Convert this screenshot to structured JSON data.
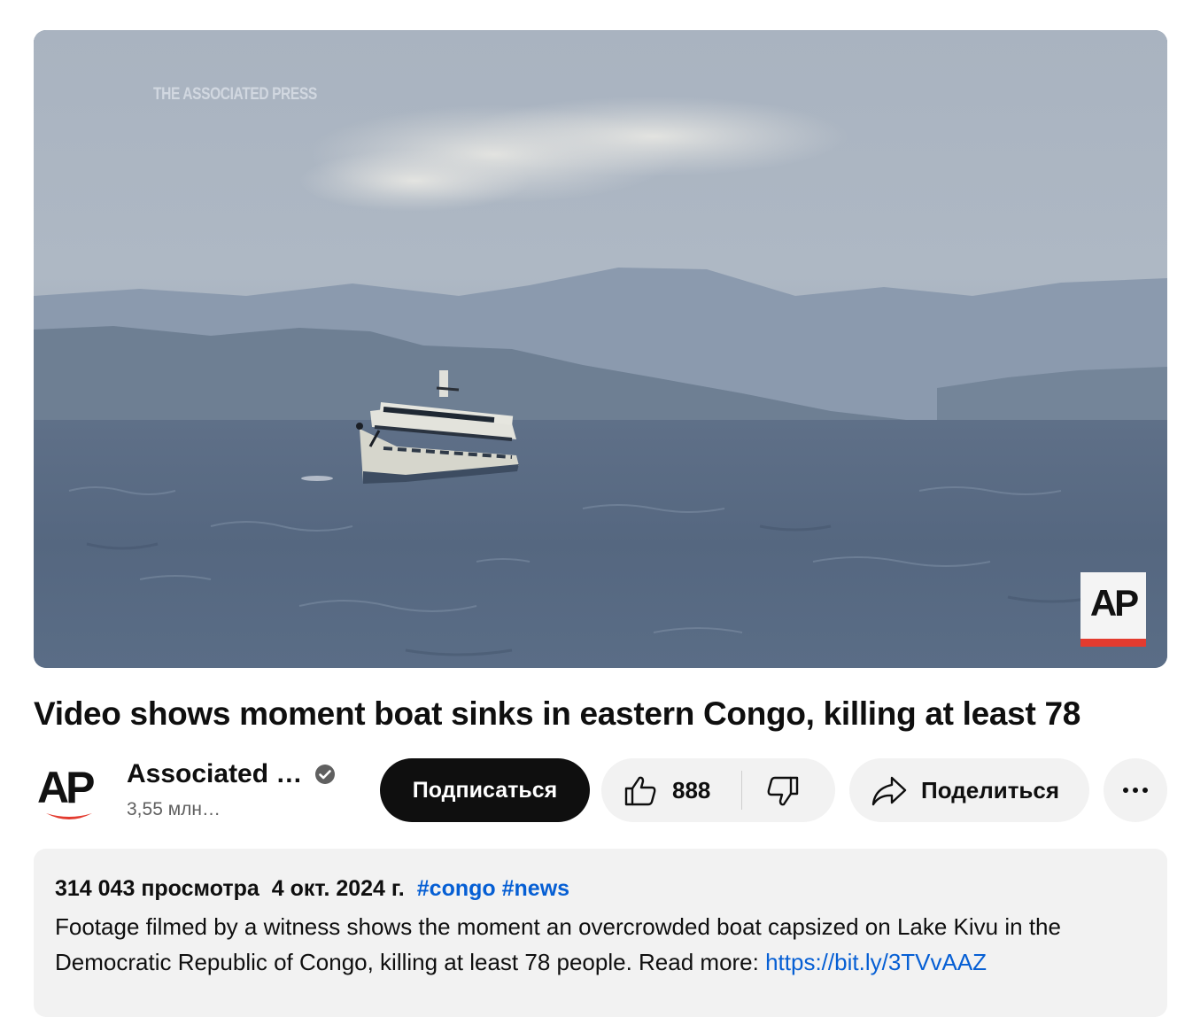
{
  "video": {
    "watermark": "THE ASSOCIATED PRESS",
    "badge_text": "AP"
  },
  "title": "Video shows moment boat sinks in eastern Congo, killing at least 78",
  "channel": {
    "avatar_text": "AP",
    "name": "Associated …",
    "subscribers": "3,55 млн…",
    "verified_icon": "check-circle-icon"
  },
  "actions": {
    "subscribe_label": "Подписаться",
    "like_count": "888",
    "share_label": "Поделиться",
    "icons": [
      "thumb-up-icon",
      "thumb-down-icon",
      "share-arrow-icon",
      "more-icon"
    ]
  },
  "description": {
    "views": "314 043 просмотра",
    "date": "4 окт. 2024 г.",
    "hashtags": [
      "#congo",
      "#news"
    ],
    "text": "Footage filmed by a witness shows the moment an overcrowded boat capsized on Lake Kivu in the Democratic Republic of Congo, killing at least 78 people. Read more: ",
    "link": "https://bit.ly/3TVvAAZ"
  },
  "colors": {
    "subscribe_bg": "#0f0f0f",
    "button_bg": "#f2f2f2",
    "link": "#065fd4",
    "ap_red": "#e33b2f"
  }
}
